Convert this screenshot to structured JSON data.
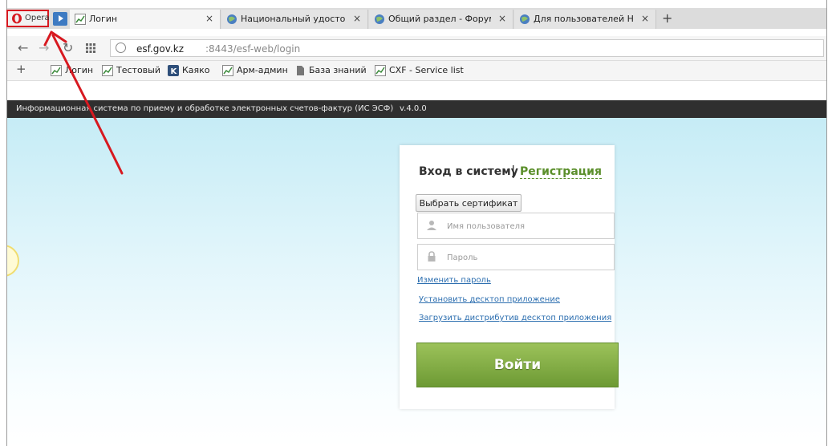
{
  "browser": {
    "opera_label": "Opera",
    "tabs": [
      {
        "label": "Логин",
        "close": "×"
      },
      {
        "label": "Национальный удостове",
        "close": "×"
      },
      {
        "label": "Общий раздел - Форум Н",
        "close": "×"
      },
      {
        "label": "Для пользователей НУЦ",
        "close": "×"
      }
    ],
    "new_tab": "+",
    "url": {
      "host": "esf.gov.kz",
      "rest": ":8443/esf-web/login"
    },
    "bookmarks": [
      {
        "label": "Логин"
      },
      {
        "label": "Тестовый"
      },
      {
        "label": "Каяко"
      },
      {
        "label": "Арм-админ"
      },
      {
        "label": "База знаний"
      },
      {
        "label": "CXF - Service list"
      }
    ],
    "bookmark_add": "+"
  },
  "app": {
    "title": "Информационная система по приему и обработке электронных счетов-фактур (ИС ЭСФ)",
    "version": "v.4.0.0"
  },
  "login": {
    "title": "Вход в систему",
    "separator": "|",
    "register": "Регистрация",
    "cert_button": "Выбрать сертификат",
    "username_placeholder": "Имя пользователя",
    "password_placeholder": "Пароль",
    "change_password": "Изменить пароль",
    "install_desktop": "Установить десктоп приложение",
    "download_desktop": "Загрузить дистрибутив десктоп приложения",
    "submit": "Войти"
  },
  "colors": {
    "accent_green": "#6d9a34",
    "link_blue": "#2d6fb0",
    "header_dark": "#2f2f2f",
    "annotation_red": "#d71920"
  }
}
